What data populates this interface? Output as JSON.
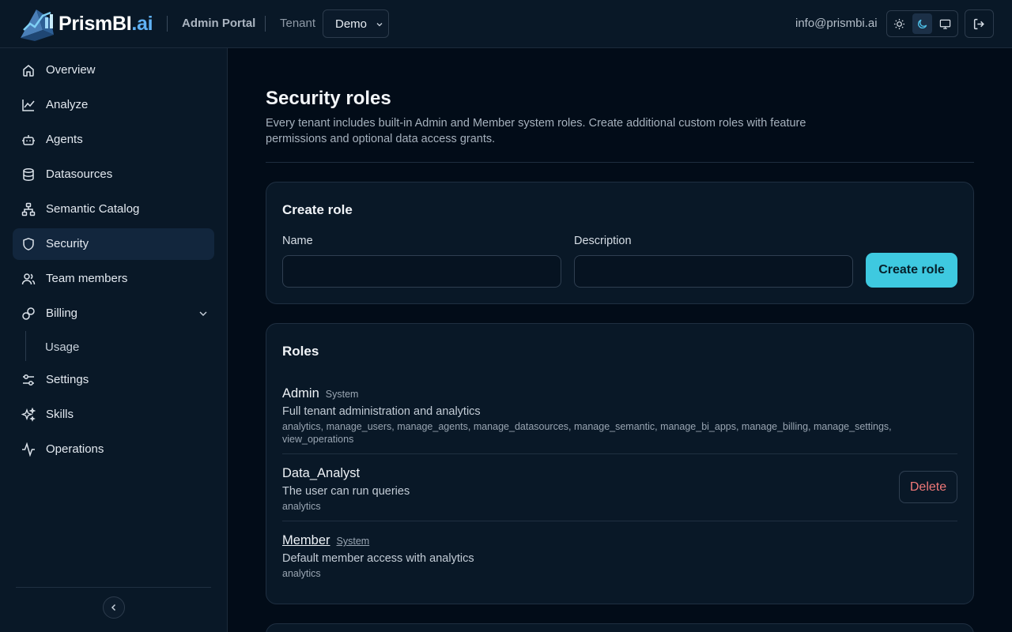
{
  "header": {
    "logo_main": "PrismBI",
    "logo_suffix": ".ai",
    "portal_label": "Admin Portal",
    "tenant_label": "Tenant",
    "tenant_value": "Demo",
    "user_email": "info@prismbi.ai",
    "theme_options": [
      "sun-icon",
      "moon-icon",
      "monitor-icon"
    ],
    "theme_active": "moon-icon"
  },
  "sidebar": {
    "items": [
      {
        "label": "Overview",
        "icon": "home-icon"
      },
      {
        "label": "Analyze",
        "icon": "line-chart-icon"
      },
      {
        "label": "Agents",
        "icon": "bot-icon"
      },
      {
        "label": "Datasources",
        "icon": "database-icon"
      },
      {
        "label": "Semantic Catalog",
        "icon": "network-icon"
      },
      {
        "label": "Security",
        "icon": "shield-icon"
      },
      {
        "label": "Team members",
        "icon": "users-icon"
      },
      {
        "label": "Billing",
        "icon": "link-icon"
      },
      {
        "label": "Settings",
        "icon": "sliders-icon"
      },
      {
        "label": "Skills",
        "icon": "sparkles-icon"
      },
      {
        "label": "Operations",
        "icon": "activity-icon"
      }
    ],
    "active": "Security",
    "billing_subitems": [
      "Usage"
    ]
  },
  "page": {
    "title": "Security roles",
    "description": "Every tenant includes built-in Admin and Member system roles. Create additional custom roles with feature permissions and optional data access grants."
  },
  "create_role": {
    "title": "Create role",
    "name_label": "Name",
    "name_value": "",
    "description_label": "Description",
    "description_value": "",
    "submit_label": "Create role"
  },
  "roles": {
    "title": "Roles",
    "items": [
      {
        "name": "Admin",
        "badge": "System",
        "description": "Full tenant administration and analytics",
        "permissions": "analytics, manage_users, manage_agents, manage_datasources, manage_semantic, manage_bi_apps, manage_billing, manage_settings, view_operations"
      },
      {
        "name": "Data_Analyst",
        "badge": "",
        "description": "The user can run queries",
        "permissions": "analytics",
        "delete_label": "Delete"
      },
      {
        "name": "Member",
        "badge": "System",
        "description": "Default member access with analytics",
        "permissions": "analytics"
      }
    ]
  },
  "colors": {
    "accent": "#3ec9e0",
    "danger": "#f07878",
    "background": "#020c18",
    "panel": "#091827"
  }
}
